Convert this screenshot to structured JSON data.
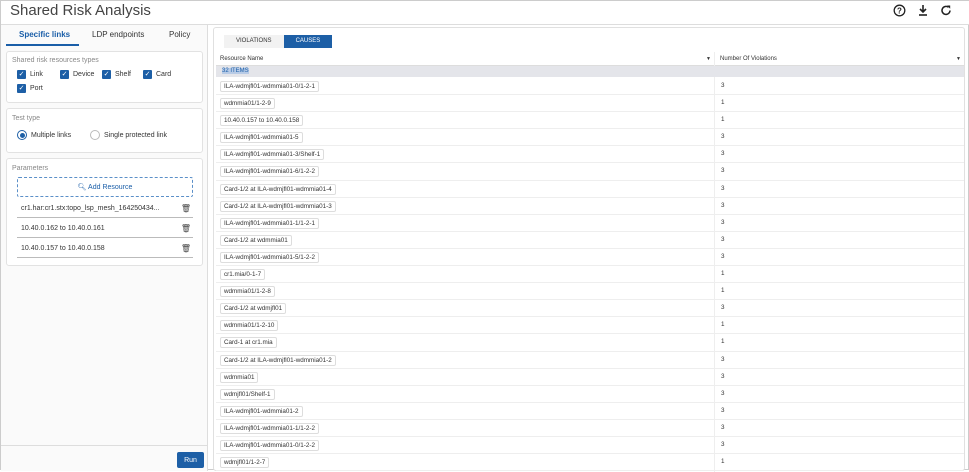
{
  "header": {
    "title": "Shared Risk Analysis",
    "icons": [
      "help-icon",
      "download-icon",
      "refresh-icon"
    ]
  },
  "left": {
    "tabs": [
      {
        "label": "Specific links",
        "active": true
      },
      {
        "label": "LDP endpoints"
      },
      {
        "label": "Policy"
      }
    ],
    "resource_types": {
      "label": "Shared risk resources types",
      "items": [
        {
          "label": "Link",
          "checked": true
        },
        {
          "label": "Device",
          "checked": true
        },
        {
          "label": "Shelf",
          "checked": true
        },
        {
          "label": "Card",
          "checked": true
        },
        {
          "label": "Port",
          "checked": true
        }
      ]
    },
    "test_type": {
      "label": "Test type",
      "options": [
        {
          "label": "Multiple links",
          "selected": true
        },
        {
          "label": "Single protected link",
          "selected": false
        }
      ]
    },
    "parameters": {
      "label": "Parameters",
      "add_label": "Add Resource",
      "items": [
        "cr1.har:cr1.stx:topo_lsp_mesh_164250434...",
        "10.40.0.162 to 10.40.0.161",
        "10.40.0.157 to 10.40.0.158"
      ]
    },
    "run_label": "Run"
  },
  "right": {
    "segments": [
      {
        "label": "VIOLATIONS"
      },
      {
        "label": "CAUSES",
        "active": true
      }
    ],
    "columns": [
      "Resource Name",
      "Number Of Violations"
    ],
    "group_label": "32 ITEMS",
    "rows": [
      {
        "name": "ILA-wdmjfl01-wdmmia01-0/1-2-1",
        "count": "3"
      },
      {
        "name": "wdmmia01/1-2-9",
        "count": "1"
      },
      {
        "name": "10.40.0.157 to 10.40.0.158",
        "count": "1"
      },
      {
        "name": "ILA-wdmjfl01-wdmmia01-5",
        "count": "3"
      },
      {
        "name": "ILA-wdmjfl01-wdmmia01-3/Shelf-1",
        "count": "3"
      },
      {
        "name": "ILA-wdmjfl01-wdmmia01-6/1-2-2",
        "count": "3"
      },
      {
        "name": "Card-1/2 at ILA-wdmjfl01-wdmmia01-4",
        "count": "3"
      },
      {
        "name": "Card-1/2 at ILA-wdmjfl01-wdmmia01-3",
        "count": "3"
      },
      {
        "name": "ILA-wdmjfl01-wdmmia01-1/1-2-1",
        "count": "3"
      },
      {
        "name": "Card-1/2 at wdmmia01",
        "count": "3"
      },
      {
        "name": "ILA-wdmjfl01-wdmmia01-5/1-2-2",
        "count": "3"
      },
      {
        "name": "cr1.mia/0-1-7",
        "count": "1"
      },
      {
        "name": "wdmmia01/1-2-8",
        "count": "1"
      },
      {
        "name": "Card-1/2 at wdmjfl01",
        "count": "3"
      },
      {
        "name": "wdmmia01/1-2-10",
        "count": "1"
      },
      {
        "name": "Card-1 at cr1.mia",
        "count": "1"
      },
      {
        "name": "Card-1/2 at ILA-wdmjfl01-wdmmia01-2",
        "count": "3"
      },
      {
        "name": "wdmmia01",
        "count": "3"
      },
      {
        "name": "wdmjfl01/Shelf-1",
        "count": "3"
      },
      {
        "name": "ILA-wdmjfl01-wdmmia01-2",
        "count": "3"
      },
      {
        "name": "ILA-wdmjfl01-wdmmia01-1/1-2-2",
        "count": "3"
      },
      {
        "name": "ILA-wdmjfl01-wdmmia01-0/1-2-2",
        "count": "3"
      },
      {
        "name": "wdmjfl01/1-2-7",
        "count": "1"
      }
    ]
  },
  "colors": {
    "accent": "#1d5fa6",
    "group_bg": "#e4e5ea"
  }
}
